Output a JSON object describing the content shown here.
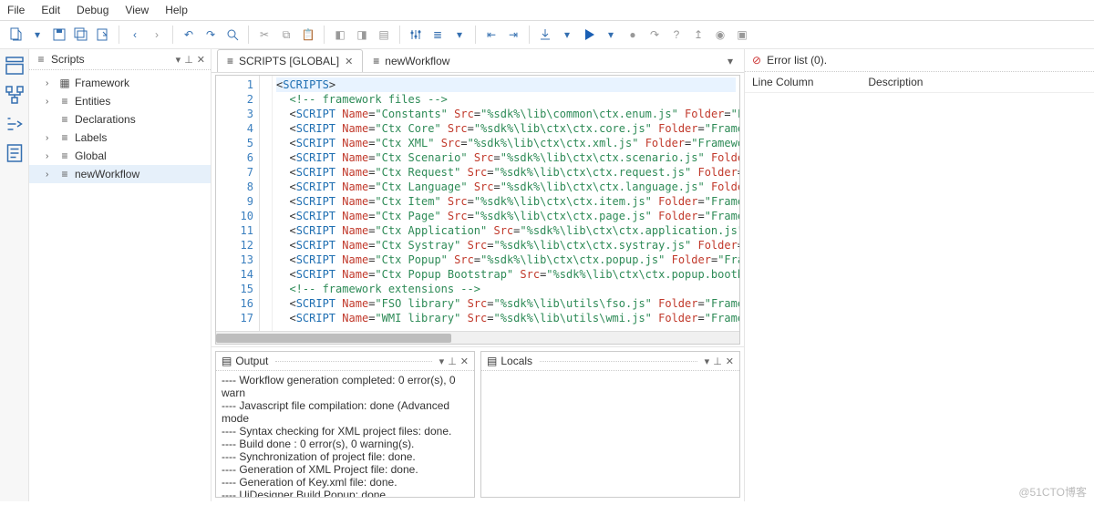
{
  "menu": {
    "file": "File",
    "edit": "Edit",
    "debug": "Debug",
    "view": "View",
    "help": "Help"
  },
  "scripts_panel": {
    "title": "Scripts",
    "items": [
      {
        "label": "Framework"
      },
      {
        "label": "Entities"
      },
      {
        "label": "Declarations"
      },
      {
        "label": "Labels"
      },
      {
        "label": "Global"
      },
      {
        "label": "newWorkflow"
      }
    ]
  },
  "tabs": [
    {
      "label": "SCRIPTS [GLOBAL]",
      "closable": true,
      "active": true
    },
    {
      "label": "newWorkflow",
      "closable": false,
      "active": false
    }
  ],
  "editor": {
    "lines": [
      {
        "n": 1,
        "hl": true,
        "seg": [
          [
            "t-punc",
            "<"
          ],
          [
            "t-tag",
            "SCRIPTS"
          ],
          [
            "t-punc",
            ">"
          ]
        ]
      },
      {
        "n": 2,
        "seg": [
          [
            "t-punc",
            "  "
          ],
          [
            "t-cmt",
            "<!-- framework files -->"
          ]
        ]
      },
      {
        "n": 3,
        "seg": [
          [
            "t-punc",
            "  <"
          ],
          [
            "t-tag",
            "SCRIPT"
          ],
          [
            "t-punc",
            " "
          ],
          [
            "t-attr",
            "Name"
          ],
          [
            "t-punc",
            "="
          ],
          [
            "t-str",
            "\"Constants\""
          ],
          [
            "t-punc",
            " "
          ],
          [
            "t-attr",
            "Src"
          ],
          [
            "t-punc",
            "="
          ],
          [
            "t-str",
            "\"%sdk%\\lib\\common\\ctx.enum.js\""
          ],
          [
            "t-punc",
            " "
          ],
          [
            "t-attr",
            "Folder"
          ],
          [
            "t-punc",
            "="
          ],
          [
            "t-str",
            "\"Fra"
          ]
        ]
      },
      {
        "n": 4,
        "seg": [
          [
            "t-punc",
            "  <"
          ],
          [
            "t-tag",
            "SCRIPT"
          ],
          [
            "t-punc",
            " "
          ],
          [
            "t-attr",
            "Name"
          ],
          [
            "t-punc",
            "="
          ],
          [
            "t-str",
            "\"Ctx Core\""
          ],
          [
            "t-punc",
            " "
          ],
          [
            "t-attr",
            "Src"
          ],
          [
            "t-punc",
            "="
          ],
          [
            "t-str",
            "\"%sdk%\\lib\\ctx\\ctx.core.js\""
          ],
          [
            "t-punc",
            " "
          ],
          [
            "t-attr",
            "Folder"
          ],
          [
            "t-punc",
            "="
          ],
          [
            "t-str",
            "\"Framewo"
          ]
        ]
      },
      {
        "n": 5,
        "seg": [
          [
            "t-punc",
            "  <"
          ],
          [
            "t-tag",
            "SCRIPT"
          ],
          [
            "t-punc",
            " "
          ],
          [
            "t-attr",
            "Name"
          ],
          [
            "t-punc",
            "="
          ],
          [
            "t-str",
            "\"Ctx XML\""
          ],
          [
            "t-punc",
            " "
          ],
          [
            "t-attr",
            "Src"
          ],
          [
            "t-punc",
            "="
          ],
          [
            "t-str",
            "\"%sdk%\\lib\\ctx\\ctx.xml.js\""
          ],
          [
            "t-punc",
            " "
          ],
          [
            "t-attr",
            "Folder"
          ],
          [
            "t-punc",
            "="
          ],
          [
            "t-str",
            "\"Framework"
          ]
        ]
      },
      {
        "n": 6,
        "seg": [
          [
            "t-punc",
            "  <"
          ],
          [
            "t-tag",
            "SCRIPT"
          ],
          [
            "t-punc",
            " "
          ],
          [
            "t-attr",
            "Name"
          ],
          [
            "t-punc",
            "="
          ],
          [
            "t-str",
            "\"Ctx Scenario\""
          ],
          [
            "t-punc",
            " "
          ],
          [
            "t-attr",
            "Src"
          ],
          [
            "t-punc",
            "="
          ],
          [
            "t-str",
            "\"%sdk%\\lib\\ctx\\ctx.scenario.js\""
          ],
          [
            "t-punc",
            " "
          ],
          [
            "t-attr",
            "Folder"
          ],
          [
            "t-punc",
            "="
          ]
        ]
      },
      {
        "n": 7,
        "seg": [
          [
            "t-punc",
            "  <"
          ],
          [
            "t-tag",
            "SCRIPT"
          ],
          [
            "t-punc",
            " "
          ],
          [
            "t-attr",
            "Name"
          ],
          [
            "t-punc",
            "="
          ],
          [
            "t-str",
            "\"Ctx Request\""
          ],
          [
            "t-punc",
            " "
          ],
          [
            "t-attr",
            "Src"
          ],
          [
            "t-punc",
            "="
          ],
          [
            "t-str",
            "\"%sdk%\\lib\\ctx\\ctx.request.js\""
          ],
          [
            "t-punc",
            " "
          ],
          [
            "t-attr",
            "Folder"
          ],
          [
            "t-punc",
            "="
          ],
          [
            "t-str",
            "\"F"
          ]
        ]
      },
      {
        "n": 8,
        "seg": [
          [
            "t-punc",
            "  <"
          ],
          [
            "t-tag",
            "SCRIPT"
          ],
          [
            "t-punc",
            " "
          ],
          [
            "t-attr",
            "Name"
          ],
          [
            "t-punc",
            "="
          ],
          [
            "t-str",
            "\"Ctx Language\""
          ],
          [
            "t-punc",
            " "
          ],
          [
            "t-attr",
            "Src"
          ],
          [
            "t-punc",
            "="
          ],
          [
            "t-str",
            "\"%sdk%\\lib\\ctx\\ctx.language.js\""
          ],
          [
            "t-punc",
            " "
          ],
          [
            "t-attr",
            "Folder"
          ],
          [
            "t-punc",
            "="
          ]
        ]
      },
      {
        "n": 9,
        "seg": [
          [
            "t-punc",
            "  <"
          ],
          [
            "t-tag",
            "SCRIPT"
          ],
          [
            "t-punc",
            " "
          ],
          [
            "t-attr",
            "Name"
          ],
          [
            "t-punc",
            "="
          ],
          [
            "t-str",
            "\"Ctx Item\""
          ],
          [
            "t-punc",
            " "
          ],
          [
            "t-attr",
            "Src"
          ],
          [
            "t-punc",
            "="
          ],
          [
            "t-str",
            "\"%sdk%\\lib\\ctx\\ctx.item.js\""
          ],
          [
            "t-punc",
            " "
          ],
          [
            "t-attr",
            "Folder"
          ],
          [
            "t-punc",
            "="
          ],
          [
            "t-str",
            "\"Framewo"
          ]
        ]
      },
      {
        "n": 10,
        "seg": [
          [
            "t-punc",
            "  <"
          ],
          [
            "t-tag",
            "SCRIPT"
          ],
          [
            "t-punc",
            " "
          ],
          [
            "t-attr",
            "Name"
          ],
          [
            "t-punc",
            "="
          ],
          [
            "t-str",
            "\"Ctx Page\""
          ],
          [
            "t-punc",
            " "
          ],
          [
            "t-attr",
            "Src"
          ],
          [
            "t-punc",
            "="
          ],
          [
            "t-str",
            "\"%sdk%\\lib\\ctx\\ctx.page.js\""
          ],
          [
            "t-punc",
            " "
          ],
          [
            "t-attr",
            "Folder"
          ],
          [
            "t-punc",
            "="
          ],
          [
            "t-str",
            "\"Framewo"
          ]
        ]
      },
      {
        "n": 11,
        "seg": [
          [
            "t-punc",
            "  <"
          ],
          [
            "t-tag",
            "SCRIPT"
          ],
          [
            "t-punc",
            " "
          ],
          [
            "t-attr",
            "Name"
          ],
          [
            "t-punc",
            "="
          ],
          [
            "t-str",
            "\"Ctx Application\""
          ],
          [
            "t-punc",
            " "
          ],
          [
            "t-attr",
            "Src"
          ],
          [
            "t-punc",
            "="
          ],
          [
            "t-str",
            "\"%sdk%\\lib\\ctx\\ctx.application.js\""
          ],
          [
            "t-punc",
            " "
          ],
          [
            "t-attr",
            "F"
          ]
        ]
      },
      {
        "n": 12,
        "seg": [
          [
            "t-punc",
            "  <"
          ],
          [
            "t-tag",
            "SCRIPT"
          ],
          [
            "t-punc",
            " "
          ],
          [
            "t-attr",
            "Name"
          ],
          [
            "t-punc",
            "="
          ],
          [
            "t-str",
            "\"Ctx Systray\""
          ],
          [
            "t-punc",
            " "
          ],
          [
            "t-attr",
            "Src"
          ],
          [
            "t-punc",
            "="
          ],
          [
            "t-str",
            "\"%sdk%\\lib\\ctx\\ctx.systray.js\""
          ],
          [
            "t-punc",
            " "
          ],
          [
            "t-attr",
            "Folder"
          ],
          [
            "t-punc",
            "="
          ],
          [
            "t-str",
            "\"F"
          ]
        ]
      },
      {
        "n": 13,
        "seg": [
          [
            "t-punc",
            "  <"
          ],
          [
            "t-tag",
            "SCRIPT"
          ],
          [
            "t-punc",
            " "
          ],
          [
            "t-attr",
            "Name"
          ],
          [
            "t-punc",
            "="
          ],
          [
            "t-str",
            "\"Ctx Popup\""
          ],
          [
            "t-punc",
            " "
          ],
          [
            "t-attr",
            "Src"
          ],
          [
            "t-punc",
            "="
          ],
          [
            "t-str",
            "\"%sdk%\\lib\\ctx\\ctx.popup.js\""
          ],
          [
            "t-punc",
            " "
          ],
          [
            "t-attr",
            "Folder"
          ],
          [
            "t-punc",
            "="
          ],
          [
            "t-str",
            "\"Frame"
          ]
        ]
      },
      {
        "n": 14,
        "seg": [
          [
            "t-punc",
            "  <"
          ],
          [
            "t-tag",
            "SCRIPT"
          ],
          [
            "t-punc",
            " "
          ],
          [
            "t-attr",
            "Name"
          ],
          [
            "t-punc",
            "="
          ],
          [
            "t-str",
            "\"Ctx Popup Bootstrap\""
          ],
          [
            "t-punc",
            " "
          ],
          [
            "t-attr",
            "Src"
          ],
          [
            "t-punc",
            "="
          ],
          [
            "t-str",
            "\"%sdk%\\lib\\ctx\\ctx.popup.bootbox"
          ]
        ]
      },
      {
        "n": 15,
        "seg": [
          [
            "t-punc",
            "  "
          ],
          [
            "t-cmt",
            "<!-- framework extensions -->"
          ]
        ]
      },
      {
        "n": 16,
        "seg": [
          [
            "t-punc",
            "  <"
          ],
          [
            "t-tag",
            "SCRIPT"
          ],
          [
            "t-punc",
            " "
          ],
          [
            "t-attr",
            "Name"
          ],
          [
            "t-punc",
            "="
          ],
          [
            "t-str",
            "\"FSO library\""
          ],
          [
            "t-punc",
            " "
          ],
          [
            "t-attr",
            "Src"
          ],
          [
            "t-punc",
            "="
          ],
          [
            "t-str",
            "\"%sdk%\\lib\\utils\\fso.js\""
          ],
          [
            "t-punc",
            " "
          ],
          [
            "t-attr",
            "Folder"
          ],
          [
            "t-punc",
            "="
          ],
          [
            "t-str",
            "\"Framewo"
          ]
        ]
      },
      {
        "n": 17,
        "seg": [
          [
            "t-punc",
            "  <"
          ],
          [
            "t-tag",
            "SCRIPT"
          ],
          [
            "t-punc",
            " "
          ],
          [
            "t-attr",
            "Name"
          ],
          [
            "t-punc",
            "="
          ],
          [
            "t-str",
            "\"WMI library\""
          ],
          [
            "t-punc",
            " "
          ],
          [
            "t-attr",
            "Src"
          ],
          [
            "t-punc",
            "="
          ],
          [
            "t-str",
            "\"%sdk%\\lib\\utils\\wmi.js\""
          ],
          [
            "t-punc",
            " "
          ],
          [
            "t-attr",
            "Folder"
          ],
          [
            "t-punc",
            "="
          ],
          [
            "t-str",
            "\"Framewo"
          ]
        ]
      }
    ]
  },
  "bottom": {
    "output": {
      "title": "Output",
      "lines": [
        "---- Workflow generation completed: 0 error(s), 0 warn",
        "---- Javascript file compilation: done (Advanced mode",
        "---- Syntax checking for XML project files: done.",
        "---- Build done : 0 error(s), 0 warning(s).",
        "---- Synchronization of project file: done.",
        "---- Generation of XML Project file: done.",
        "---- Generation of Key.xml file: done.",
        "---- UiDesigner Build Popup: done."
      ]
    },
    "locals": {
      "title": "Locals"
    }
  },
  "errorlist": {
    "title": "Error list (0).",
    "cols": {
      "line": "Line",
      "column": "Column",
      "description": "Description"
    }
  },
  "watermark": "@51CTO博客"
}
